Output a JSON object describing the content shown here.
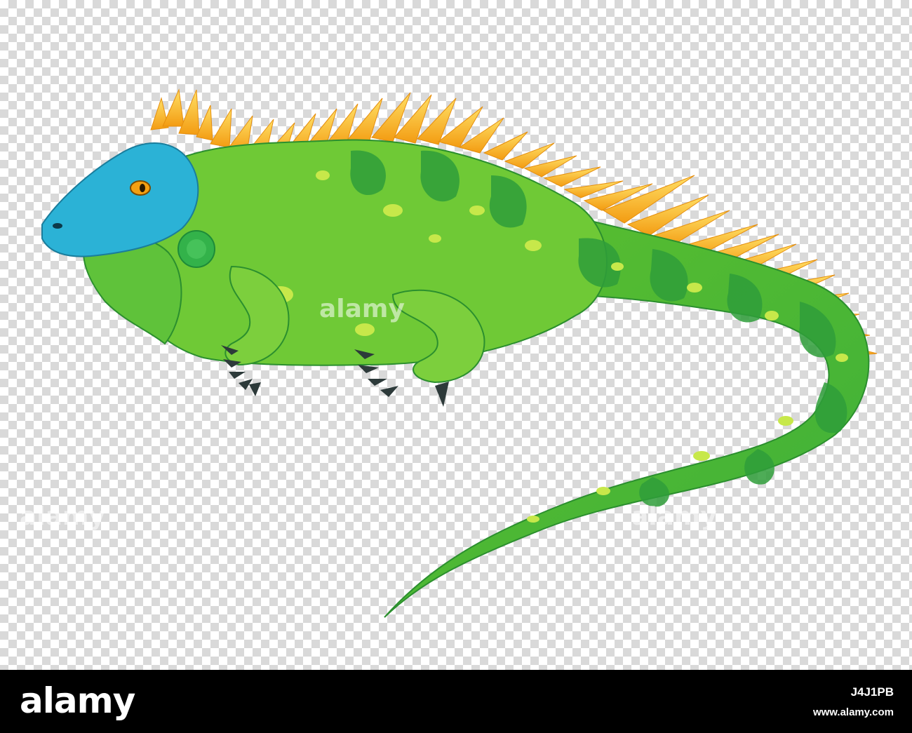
{
  "footer": {
    "brand": "alamy",
    "image_id": "J4J1PB",
    "site": "www.alamy.com"
  },
  "colors": {
    "checker_light": "#ffffff",
    "checker_dark": "#d9d9d9",
    "body_green": "#6fc936",
    "dark_green": "#2f9e3a",
    "spot_yellow_green": "#c7e84a",
    "head_blue": "#2bb2d6",
    "spikes_orange": "#f5a623",
    "spikes_yellow": "#ffd84a",
    "eye_orange": "#f4a012",
    "footer_bg": "#000000"
  }
}
